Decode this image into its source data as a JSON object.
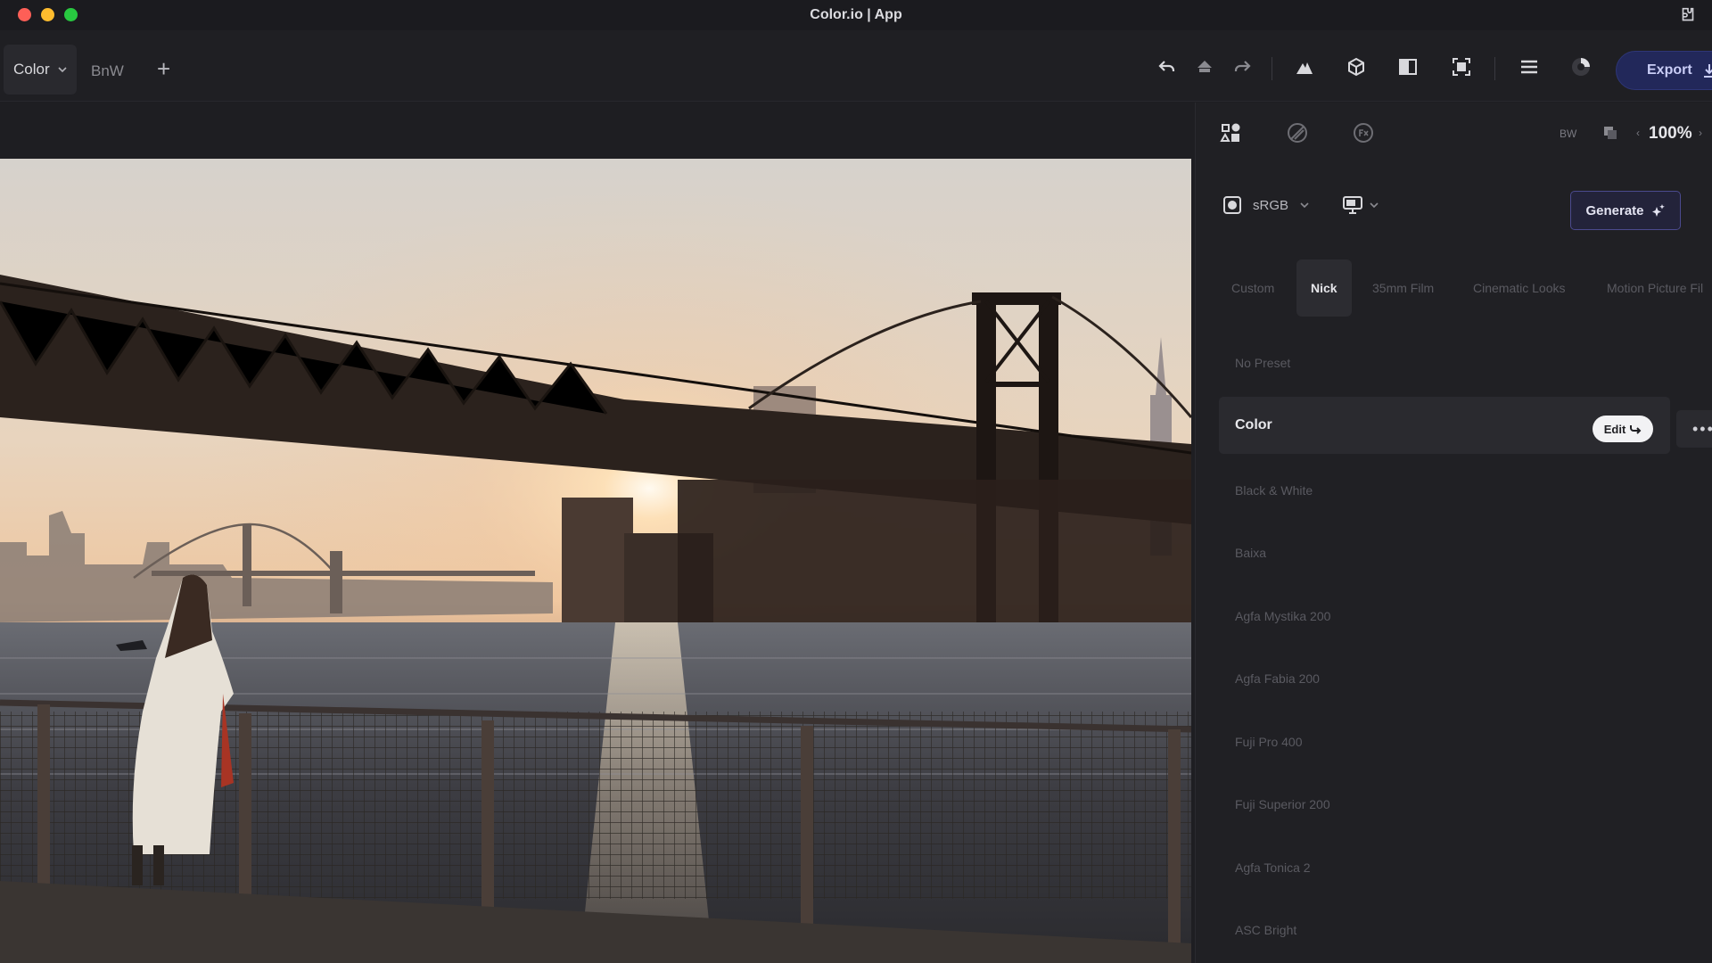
{
  "window": {
    "title": "Color.io | App"
  },
  "toolbar": {
    "tabs": [
      {
        "label": "Color"
      },
      {
        "label": "BnW"
      }
    ],
    "add_label": "+",
    "export_label": "Export"
  },
  "panel": {
    "zoom_label": "100%",
    "bw_label": "BW",
    "color_space": "sRGB",
    "generate_label": "Generate",
    "categories": [
      "Custom",
      "Nick",
      "35mm Film",
      "Cinematic Looks",
      "Motion Picture Fil"
    ],
    "presets": [
      "No Preset",
      "Color",
      "Black & White",
      "Baixa",
      "Agfa Mystika 200",
      "Agfa Fabia 200",
      "Fuji Pro 400",
      "Fuji Superior 200",
      "Agfa Tonica 2",
      "ASC Bright"
    ],
    "edit_label": "Edit",
    "more_label": "•••"
  },
  "colors": {
    "accent": "#22285a",
    "accent_border": "#4b4a8e",
    "panel_bg": "#202024",
    "active_bg": "#2a2a2f"
  }
}
